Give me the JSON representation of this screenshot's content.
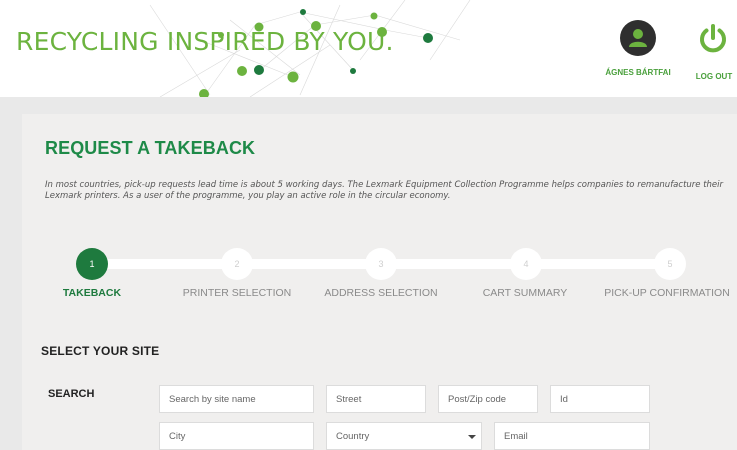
{
  "header": {
    "brand": "RECYCLING INSPIRED BY YOU.",
    "user_name": "ÁGNES BÁRTFAI",
    "logout_label": "LOG OUT"
  },
  "page": {
    "title": "REQUEST A TAKEBACK",
    "intro": "In most countries, pick-up requests lead time is about 5 working days. The Lexmark Equipment Collection Programme helps companies to remanufacture their Lexmark printers. As a user of the programme, you play an active role in the circular economy."
  },
  "steps": [
    {
      "number": "1",
      "label": "TAKEBACK",
      "active": true
    },
    {
      "number": "2",
      "label": "PRINTER SELECTION",
      "active": false
    },
    {
      "number": "3",
      "label": "ADDRESS SELECTION",
      "active": false
    },
    {
      "number": "4",
      "label": "CART SUMMARY",
      "active": false
    },
    {
      "number": "5",
      "label": "PICK-UP CONFIRMATION",
      "active": false
    }
  ],
  "site_form": {
    "section_title": "SELECT YOUR SITE",
    "search_label": "SEARCH",
    "fields": {
      "site_name": {
        "placeholder": "Search by site name"
      },
      "street": {
        "placeholder": "Street"
      },
      "postcode": {
        "placeholder": "Post/Zip code"
      },
      "id": {
        "placeholder": "Id"
      },
      "city": {
        "placeholder": "City"
      },
      "country": {
        "placeholder": "Country"
      },
      "email": {
        "placeholder": "Email"
      }
    }
  },
  "colors": {
    "brand_green": "#6cb33f",
    "dark_green": "#1e7a3e",
    "title_green": "#1e8a48"
  },
  "icons": {
    "user": "person-silhouette-icon",
    "logout": "power-icon",
    "dropdown": "chevron-down-icon"
  }
}
